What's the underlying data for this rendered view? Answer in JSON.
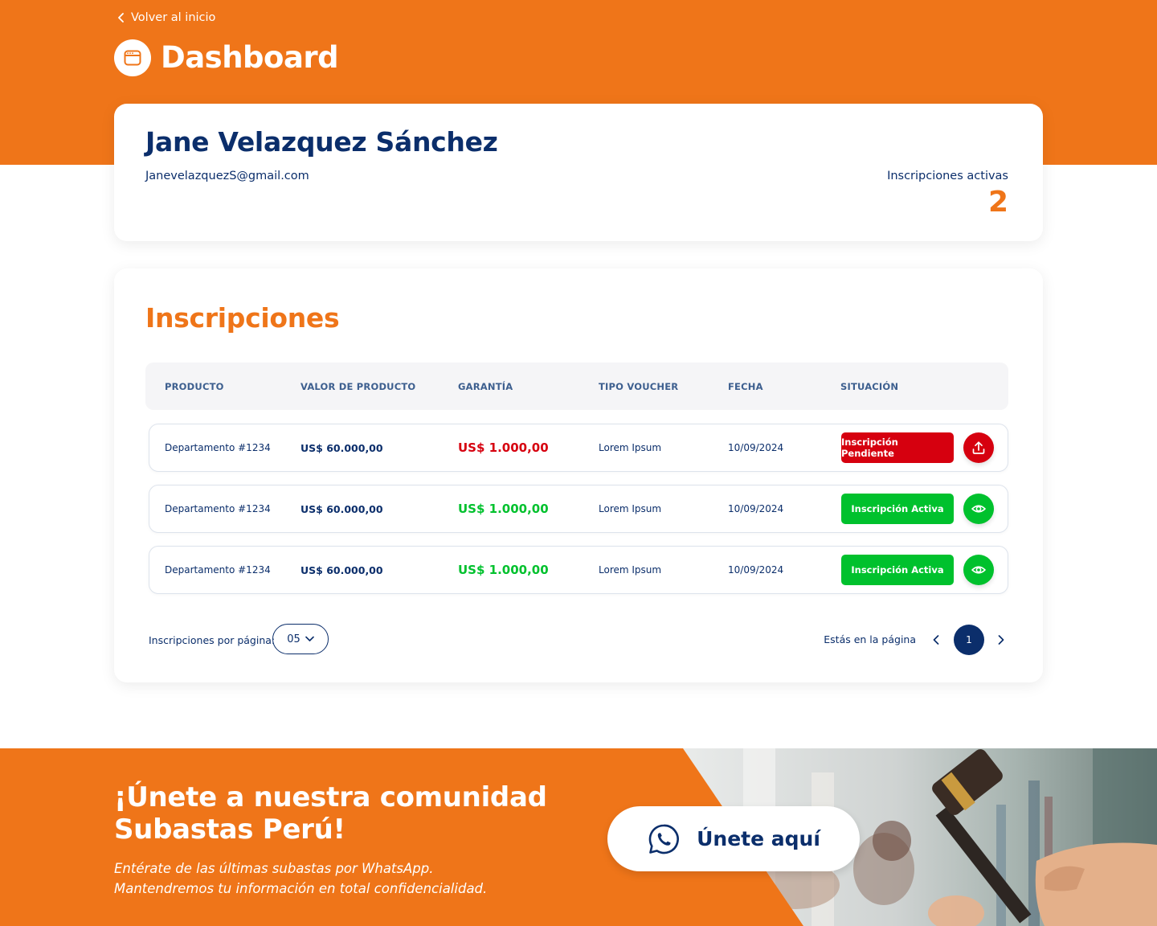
{
  "header": {
    "back_label": "Volver al inicio",
    "title": "Dashboard"
  },
  "profile": {
    "name": "Jane Velazquez Sánchez",
    "email": "JanevelazquezS@gmail.com",
    "active_label": "Inscripciones activas",
    "active_count": "2"
  },
  "registrations": {
    "title": "Inscripciones",
    "columns": {
      "product": "PRODUCTO",
      "value": "VALOR DE PRODUCTO",
      "guarantee": "GARANTÍA",
      "voucher": "TIPO VOUCHER",
      "date": "FECHA",
      "status": "SITUACIÓN"
    },
    "rows": [
      {
        "product": "Departamento #1234",
        "value": "US$ 60.000,00",
        "guarantee": "US$ 1.000,00",
        "voucher": "Lorem Ipsum",
        "date": "10/09/2024",
        "status": "Inscripción Pendiente",
        "action_icon": "upload-icon"
      },
      {
        "product": "Departamento #1234",
        "value": "US$ 60.000,00",
        "guarantee": "US$ 1.000,00",
        "voucher": "Lorem Ipsum",
        "date": "10/09/2024",
        "status": "Inscripción Activa",
        "action_icon": "eye-icon"
      },
      {
        "product": "Departamento #1234",
        "value": "US$ 60.000,00",
        "guarantee": "US$ 1.000,00",
        "voucher": "Lorem Ipsum",
        "date": "10/09/2024",
        "status": "Inscripción Activa",
        "action_icon": "eye-icon"
      }
    ],
    "pagination": {
      "per_page_label": "Inscripciones por página:",
      "per_page_value": "05",
      "page_label": "Estás en la página",
      "current_page": "1"
    }
  },
  "banner": {
    "title": "¡Únete a nuestra comunidad Subastas Perú!",
    "line1": "Entérate de las últimas subastas por WhatsApp.",
    "line2": "Mantendremos tu información en total confidencialidad.",
    "button_label": "Únete aquí"
  },
  "colors": {
    "primary_orange": "#ef7519",
    "navy": "#0b2e6b",
    "pending_red": "#d6000f",
    "active_green": "#00c12d",
    "table_header_bg": "#f5f5f7"
  }
}
